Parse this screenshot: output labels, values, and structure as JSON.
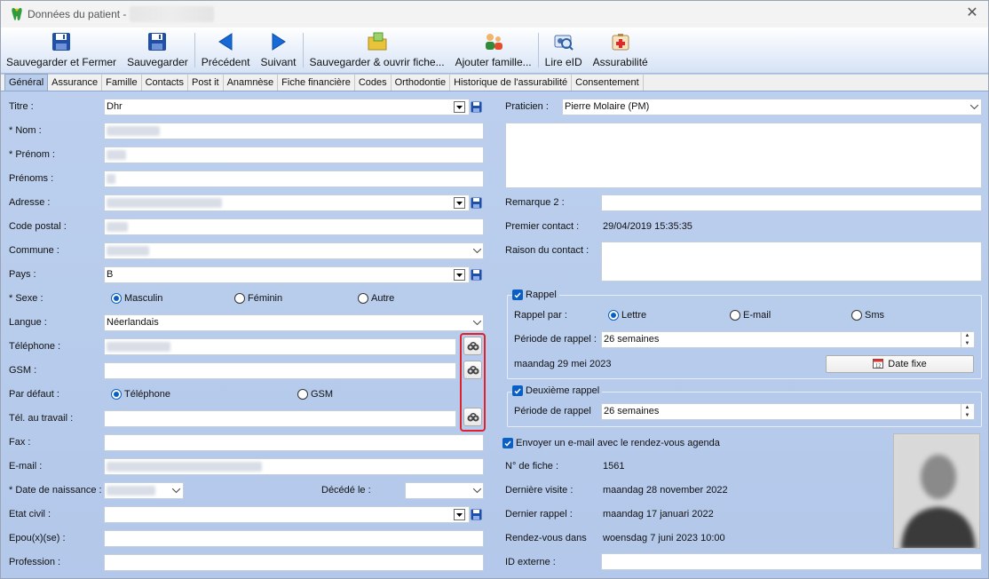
{
  "window": {
    "title": "Données du patient -"
  },
  "toolbar": {
    "save_close": "Sauvegarder et Fermer",
    "save": "Sauvegarder",
    "prev": "Précédent",
    "next": "Suivant",
    "save_open": "Sauvegarder & ouvrir fiche...",
    "add_family": "Ajouter famille...",
    "read_eid": "Lire eID",
    "insurability": "Assurabilité"
  },
  "tabs": [
    "Général",
    "Assurance",
    "Famille",
    "Contacts",
    "Post it",
    "Anamnèse",
    "Fiche financière",
    "Codes",
    "Orthodontie",
    "Historique de l'assurabilité",
    "Consentement"
  ],
  "left": {
    "titre_label": "Titre :",
    "titre_value": "Dhr",
    "nom_label": "* Nom :",
    "prenom_label": "* Prénom :",
    "prenoms_label": "Prénoms :",
    "adresse_label": "Adresse :",
    "cp_label": "Code postal :",
    "commune_label": "Commune :",
    "pays_label": "Pays :",
    "pays_value": "B",
    "sexe_label": "* Sexe :",
    "sexe_m": "Masculin",
    "sexe_f": "Féminin",
    "sexe_o": "Autre",
    "langue_label": "Langue :",
    "langue_value": "Néerlandais",
    "tel_label": "Téléphone :",
    "gsm_label": "GSM :",
    "defaut_label": "Par défaut :",
    "defaut_tel": "Téléphone",
    "defaut_gsm": "GSM",
    "teltravail_label": "Tél. au travail :",
    "fax_label": "Fax :",
    "email_label": "E-mail :",
    "dob_label": "* Date de naissance :",
    "decede_label": "Décédé le :",
    "etat_label": "Etat civil :",
    "epoux_label": "Epou(x)(se) :",
    "profession_label": "Profession :"
  },
  "right": {
    "praticien_label": "Praticien :",
    "praticien_value": "Pierre Molaire (PM)",
    "remarque2_label": "Remarque 2 :",
    "premier_label": "Premier contact :",
    "premier_value": "29/04/2019 15:35:35",
    "raison_label": "Raison du contact :",
    "rappel_label": "Rappel",
    "rappel_par_label": "Rappel par :",
    "rappel_lettre": "Lettre",
    "rappel_email": "E-mail",
    "rappel_sms": "Sms",
    "periode_label": "Période de rappel :",
    "periode_value": "26 semaines",
    "rappel_date": "maandag 29 mei 2023",
    "date_fixe": "Date fixe",
    "deuxieme_label": "Deuxième rappel",
    "periode2_label": "Période de rappel",
    "periode2_value": "26 semaines",
    "envoyer_label": "Envoyer un e-mail avec le rendez-vous agenda",
    "fiche_label": "N° de fiche :",
    "fiche_value": "1561",
    "derniere_visite_label": "Dernière visite :",
    "derniere_visite_value": "maandag 28 november 2022",
    "dernier_rappel_label": "Dernier rappel :",
    "dernier_rappel_value": "maandag 17 januari 2022",
    "rdv_label": "Rendez-vous dans",
    "rdv_value": "woensdag 7 juni 2023 10:00",
    "id_externe_label": "ID externe :"
  }
}
